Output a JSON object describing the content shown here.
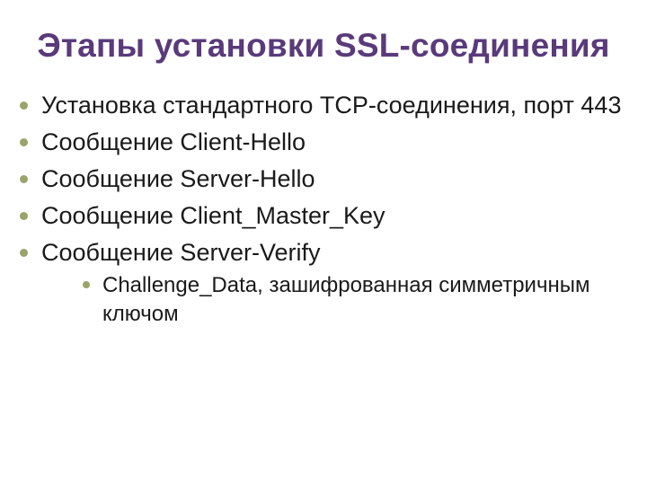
{
  "title": "Этапы установки SSL-соединения",
  "items": [
    "Установка стандартного TCP-соединения, порт 443",
    "Сообщение Client-Hello",
    "Сообщение Server-Hello",
    "Сообщение Client_Master_Key",
    "Сообщение Server-Verify"
  ],
  "subitems": [
    "Challenge_Data, зашифрованная симметричным ключом"
  ]
}
